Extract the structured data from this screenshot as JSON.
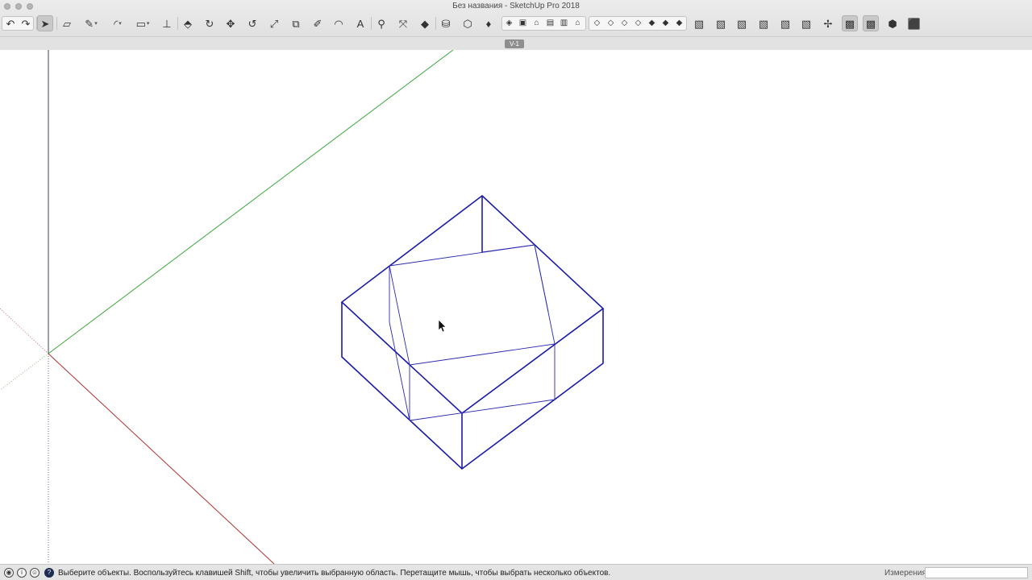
{
  "window": {
    "title": "Без названия - SketchUp Pro 2018"
  },
  "toolbar": {
    "main_tools": [
      {
        "name": "undo-icon",
        "glyph": "↶"
      },
      {
        "name": "redo-icon",
        "glyph": "↷"
      },
      {
        "name": "select-icon",
        "glyph": "➤"
      },
      {
        "name": "eraser-icon",
        "glyph": "▱"
      },
      {
        "name": "line-icon",
        "glyph": "✎"
      },
      {
        "name": "arc-icon",
        "glyph": "◜"
      },
      {
        "name": "rectangle-icon",
        "glyph": "▭"
      },
      {
        "name": "axis-icon",
        "glyph": "⊥"
      },
      {
        "name": "push-pull-icon",
        "glyph": "⬘"
      },
      {
        "name": "follow-me-icon",
        "glyph": "↻"
      },
      {
        "name": "move-icon",
        "glyph": "✥"
      },
      {
        "name": "rotate-icon",
        "glyph": "↺"
      },
      {
        "name": "scale-icon",
        "glyph": "⤢"
      },
      {
        "name": "offset-icon",
        "glyph": "⧉"
      },
      {
        "name": "tape-measure-icon",
        "glyph": "✐"
      },
      {
        "name": "protractor-icon",
        "glyph": "◠"
      },
      {
        "name": "text-icon",
        "glyph": "A"
      },
      {
        "name": "zoom-icon",
        "glyph": "⚲"
      },
      {
        "name": "zoom-extents-icon",
        "glyph": "⤧"
      },
      {
        "name": "section-plane-icon",
        "glyph": "◆"
      },
      {
        "name": "warehouse-icon",
        "glyph": "⛁"
      },
      {
        "name": "extension-icon",
        "glyph": "⬡"
      },
      {
        "name": "ruby-icon",
        "glyph": "♦"
      }
    ],
    "view_tools": [
      {
        "name": "iso-view-icon",
        "glyph": "◈"
      },
      {
        "name": "top-view-icon",
        "glyph": "▣"
      },
      {
        "name": "front-view-icon",
        "glyph": "⌂"
      },
      {
        "name": "right-view-icon",
        "glyph": "▤"
      },
      {
        "name": "back-view-icon",
        "glyph": "▥"
      },
      {
        "name": "left-view-icon",
        "glyph": "⌂"
      }
    ],
    "style_tools": [
      {
        "name": "xray-icon",
        "glyph": "◇"
      },
      {
        "name": "back-edges-icon",
        "glyph": "◇"
      },
      {
        "name": "wireframe-icon",
        "glyph": "◇"
      },
      {
        "name": "hidden-line-icon",
        "glyph": "◇"
      },
      {
        "name": "shaded-icon",
        "glyph": "◆"
      },
      {
        "name": "shaded-textures-icon",
        "glyph": "◆"
      },
      {
        "name": "monochrome-icon",
        "glyph": "◆"
      }
    ],
    "right_tools": [
      {
        "name": "solid-union-icon",
        "glyph": "▧"
      },
      {
        "name": "solid-subtract-icon",
        "glyph": "▧"
      },
      {
        "name": "solid-trim-icon",
        "glyph": "▧"
      },
      {
        "name": "solid-intersect-icon",
        "glyph": "▧"
      },
      {
        "name": "solid-outer-shell-icon",
        "glyph": "▧"
      },
      {
        "name": "solid-split-icon",
        "glyph": "▧"
      },
      {
        "name": "orbit-icon",
        "glyph": "✢"
      },
      {
        "name": "sandbox-icon",
        "glyph": "▩"
      },
      {
        "name": "layers-icon",
        "glyph": "▩"
      },
      {
        "name": "components-icon",
        "glyph": "⬢"
      },
      {
        "name": "materials-icon",
        "glyph": "⬛"
      }
    ]
  },
  "tabs": {
    "scene_label": "V-1"
  },
  "status": {
    "message": "Выберите объекты. Воспользуйтесь клавишей Shift, чтобы увеличить выбранную область. Перетащите мышь, чтобы выбрать несколько объектов.",
    "measure_label": "Измерения",
    "measure_value": ""
  },
  "colors": {
    "selection": "#1a1aa8",
    "axis_red": "#b03030",
    "axis_green": "#3aa83a",
    "axis_blue": "#3c3c6a"
  }
}
